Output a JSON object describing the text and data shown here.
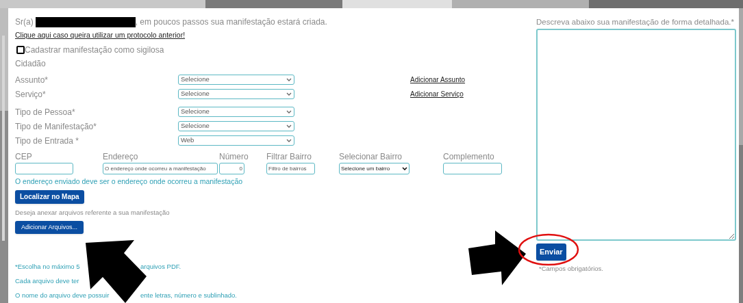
{
  "greeting": {
    "prefix": "Sr(a)",
    "suffix": ", em poucos passos sua manifestação estará criada."
  },
  "protocol_link": "Clique aqui caso queira utilizar um protocolo anterior!",
  "confidential": {
    "label": "Cadastrar manifestação como sigilosa",
    "checked": false
  },
  "section_title": "Cidadão",
  "fields": [
    {
      "label": "Assunto*",
      "value": "Selecione",
      "link": "Adicionar Assunto"
    },
    {
      "label": "Serviço*",
      "value": "Selecione",
      "link": "Adicionar Serviço"
    },
    {
      "label": "Tipo de Pessoa*",
      "value": "Selecione"
    },
    {
      "label": "Tipo de Manifestação*",
      "value": "Selecione"
    },
    {
      "label": "Tipo de Entrada *",
      "value": "Web"
    }
  ],
  "address": [
    {
      "kind": "input",
      "label": "CEP"
    },
    {
      "kind": "input",
      "label": "Endereço",
      "placeholder": "O endereço onde ocorreu a manifestação"
    },
    {
      "kind": "number",
      "label": "Número",
      "value": "0"
    },
    {
      "kind": "input",
      "label": "Filtrar Bairro",
      "placeholder": "Filtro de bairros"
    },
    {
      "kind": "select",
      "label": "Selecionar Bairro",
      "value": "Selecione um bairro"
    },
    {
      "kind": "input",
      "label": "Complemento"
    }
  ],
  "address_note": "O endereço enviado deve ser o endereço onde ocorreu a manifestação",
  "map_button": "Localizar no Mapa",
  "attach_prompt": "Deseja anexar arquivos referente a sua manifestação",
  "attach_button": "Adicionar Arquivos...",
  "notes": [
    {
      "parts": [
        "*Escolha no máximo 5",
        "arquivos PDF."
      ]
    },
    {
      "parts": [
        "Cada arquivo deve ter"
      ]
    },
    {
      "parts": [
        "O nome do arquivo deve possuir",
        "ente letras, número e sublinhado."
      ]
    }
  ],
  "description": {
    "label": "Descreva abaixo sua manifestação de forma detalhada.*"
  },
  "submit_button": "Enviar",
  "required_note": "*Campos obrigatórios."
}
